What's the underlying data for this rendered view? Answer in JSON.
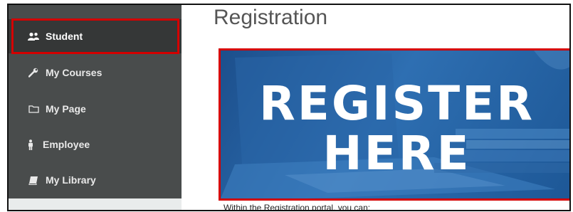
{
  "sidebar": {
    "items": [
      {
        "label": "Student",
        "icon": "users-icon",
        "active": true
      },
      {
        "label": "My Courses",
        "icon": "wrench-icon"
      },
      {
        "label": "My Page",
        "icon": "folder-icon"
      },
      {
        "label": "Employee",
        "icon": "person-icon"
      },
      {
        "label": "My Library",
        "icon": "book-icon"
      }
    ]
  },
  "main": {
    "title": "Registration",
    "banner": {
      "line1": "REGISTER",
      "line2": "HERE"
    },
    "intro": "Within the Registration portal, you can:"
  },
  "colors": {
    "sidebar_bg": "#494c4c",
    "active_bg": "#353737",
    "highlight": "#d40000",
    "banner_blue": "#2e6fb2"
  }
}
